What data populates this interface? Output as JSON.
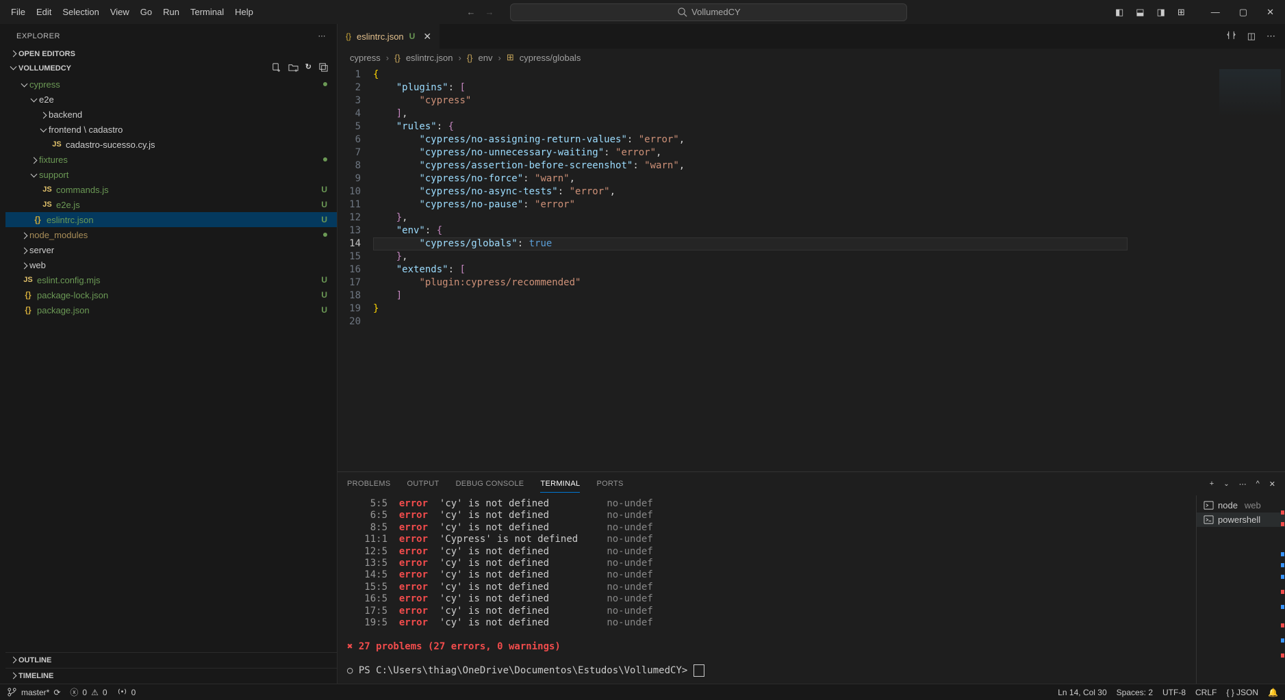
{
  "menubar": [
    "File",
    "Edit",
    "Selection",
    "View",
    "Go",
    "Run",
    "Terminal",
    "Help"
  ],
  "search_placeholder": "VollumedCY",
  "sidebar": {
    "title": "EXPLORER",
    "open_editors": "OPEN EDITORS",
    "project": "VOLLUMEDCY",
    "tree": [
      {
        "depth": 1,
        "type": "folder",
        "open": true,
        "label": "cypress",
        "git": "dot",
        "cls": "clr-green"
      },
      {
        "depth": 2,
        "type": "folder",
        "open": true,
        "label": "e2e"
      },
      {
        "depth": 3,
        "type": "folder",
        "open": false,
        "label": "backend"
      },
      {
        "depth": 3,
        "type": "folder",
        "open": true,
        "label": "frontend \\ cadastro"
      },
      {
        "depth": 4,
        "type": "file",
        "icon": "JS",
        "iconcls": "ic-js",
        "label": "cadastro-sucesso.cy.js"
      },
      {
        "depth": 2,
        "type": "folder",
        "open": false,
        "label": "fixtures",
        "git": "dot",
        "cls": "clr-green"
      },
      {
        "depth": 2,
        "type": "folder",
        "open": true,
        "label": "support",
        "cls": "clr-green"
      },
      {
        "depth": 3,
        "type": "file",
        "icon": "JS",
        "iconcls": "ic-js",
        "label": "commands.js",
        "git": "U",
        "cls": "clr-green"
      },
      {
        "depth": 3,
        "type": "file",
        "icon": "JS",
        "iconcls": "ic-js",
        "label": "e2e.js",
        "git": "U",
        "cls": "clr-green"
      },
      {
        "depth": 2,
        "type": "file",
        "icon": "{}",
        "iconcls": "ic-json",
        "label": "eslintrc.json",
        "git": "U",
        "cls": "clr-green",
        "selected": true
      },
      {
        "depth": 1,
        "type": "folder",
        "open": false,
        "label": "node_modules",
        "git": "dot",
        "cls": "clr-mod"
      },
      {
        "depth": 1,
        "type": "folder",
        "open": false,
        "label": "server"
      },
      {
        "depth": 1,
        "type": "folder",
        "open": false,
        "label": "web"
      },
      {
        "depth": 1,
        "type": "file",
        "icon": "JS",
        "iconcls": "ic-js",
        "label": "eslint.config.mjs",
        "git": "U",
        "cls": "clr-green"
      },
      {
        "depth": 1,
        "type": "file",
        "icon": "{}",
        "iconcls": "ic-json",
        "label": "package-lock.json",
        "git": "U",
        "cls": "clr-green"
      },
      {
        "depth": 1,
        "type": "file",
        "icon": "{}",
        "iconcls": "ic-json",
        "label": "package.json",
        "git": "U",
        "cls": "clr-green"
      }
    ],
    "outline": "OUTLINE",
    "timeline": "TIMELINE"
  },
  "tab": {
    "icon": "{}",
    "name": "eslintrc.json",
    "badge": "U"
  },
  "breadcrumb": [
    "cypress",
    "eslintrc.json",
    "env",
    "cypress/globals"
  ],
  "code": {
    "lines": [
      [
        [
          "brace",
          "{"
        ]
      ],
      [
        [
          "punc",
          "    "
        ],
        [
          "key",
          "\"plugins\""
        ],
        [
          "punc",
          ": "
        ],
        [
          "brace2",
          "["
        ]
      ],
      [
        [
          "punc",
          "        "
        ],
        [
          "str",
          "\"cypress\""
        ]
      ],
      [
        [
          "punc",
          "    "
        ],
        [
          "brace2",
          "]"
        ],
        [
          "punc",
          ","
        ]
      ],
      [
        [
          "punc",
          "    "
        ],
        [
          "key",
          "\"rules\""
        ],
        [
          "punc",
          ": "
        ],
        [
          "brace2",
          "{"
        ]
      ],
      [
        [
          "punc",
          "        "
        ],
        [
          "key",
          "\"cypress/no-assigning-return-values\""
        ],
        [
          "punc",
          ": "
        ],
        [
          "str",
          "\"error\""
        ],
        [
          "punc",
          ","
        ]
      ],
      [
        [
          "punc",
          "        "
        ],
        [
          "key",
          "\"cypress/no-unnecessary-waiting\""
        ],
        [
          "punc",
          ": "
        ],
        [
          "str",
          "\"error\""
        ],
        [
          "punc",
          ","
        ]
      ],
      [
        [
          "punc",
          "        "
        ],
        [
          "key",
          "\"cypress/assertion-before-screenshot\""
        ],
        [
          "punc",
          ": "
        ],
        [
          "str",
          "\"warn\""
        ],
        [
          "punc",
          ","
        ]
      ],
      [
        [
          "punc",
          "        "
        ],
        [
          "key",
          "\"cypress/no-force\""
        ],
        [
          "punc",
          ": "
        ],
        [
          "str",
          "\"warn\""
        ],
        [
          "punc",
          ","
        ]
      ],
      [
        [
          "punc",
          "        "
        ],
        [
          "key",
          "\"cypress/no-async-tests\""
        ],
        [
          "punc",
          ": "
        ],
        [
          "str",
          "\"error\""
        ],
        [
          "punc",
          ","
        ]
      ],
      [
        [
          "punc",
          "        "
        ],
        [
          "key",
          "\"cypress/no-pause\""
        ],
        [
          "punc",
          ": "
        ],
        [
          "str",
          "\"error\""
        ]
      ],
      [
        [
          "punc",
          "    "
        ],
        [
          "brace2",
          "}"
        ],
        [
          "punc",
          ","
        ]
      ],
      [
        [
          "punc",
          "    "
        ],
        [
          "key",
          "\"env\""
        ],
        [
          "punc",
          ": "
        ],
        [
          "brace2",
          "{"
        ]
      ],
      [
        [
          "punc",
          "        "
        ],
        [
          "key",
          "\"cypress/globals\""
        ],
        [
          "punc",
          ": "
        ],
        [
          "bool",
          "true"
        ]
      ],
      [
        [
          "punc",
          "    "
        ],
        [
          "brace2",
          "}"
        ],
        [
          "punc",
          ","
        ]
      ],
      [
        [
          "punc",
          "    "
        ],
        [
          "key",
          "\"extends\""
        ],
        [
          "punc",
          ": "
        ],
        [
          "brace2",
          "["
        ]
      ],
      [
        [
          "punc",
          "        "
        ],
        [
          "str",
          "\"plugin:cypress/recommended\""
        ]
      ],
      [
        [
          "punc",
          "    "
        ],
        [
          "brace2",
          "]"
        ]
      ],
      [
        [
          "punc",
          ""
        ]
      ],
      [
        [
          "brace",
          "}"
        ]
      ]
    ],
    "highlight_line": 14
  },
  "panel": {
    "tabs": [
      "PROBLEMS",
      "OUTPUT",
      "DEBUG CONSOLE",
      "TERMINAL",
      "PORTS"
    ],
    "active": "TERMINAL",
    "errors": [
      {
        "pos": "5:5",
        "sev": "error",
        "msg": "'cy' is not defined",
        "rule": "no-undef"
      },
      {
        "pos": "6:5",
        "sev": "error",
        "msg": "'cy' is not defined",
        "rule": "no-undef"
      },
      {
        "pos": "8:5",
        "sev": "error",
        "msg": "'cy' is not defined",
        "rule": "no-undef"
      },
      {
        "pos": "11:1",
        "sev": "error",
        "msg": "'Cypress' is not defined",
        "rule": "no-undef"
      },
      {
        "pos": "12:5",
        "sev": "error",
        "msg": "'cy' is not defined",
        "rule": "no-undef"
      },
      {
        "pos": "13:5",
        "sev": "error",
        "msg": "'cy' is not defined",
        "rule": "no-undef"
      },
      {
        "pos": "14:5",
        "sev": "error",
        "msg": "'cy' is not defined",
        "rule": "no-undef"
      },
      {
        "pos": "15:5",
        "sev": "error",
        "msg": "'cy' is not defined",
        "rule": "no-undef"
      },
      {
        "pos": "16:5",
        "sev": "error",
        "msg": "'cy' is not defined",
        "rule": "no-undef"
      },
      {
        "pos": "17:5",
        "sev": "error",
        "msg": "'cy' is not defined",
        "rule": "no-undef"
      },
      {
        "pos": "19:5",
        "sev": "error",
        "msg": "'cy' is not defined",
        "rule": "no-undef"
      }
    ],
    "summary": "27 problems (27 errors, 0 warnings)",
    "prompt": "PS C:\\Users\\thiag\\OneDrive\\Documentos\\Estudos\\VollumedCY>",
    "terminals": [
      {
        "icon": "node",
        "label": "node",
        "extra": "web"
      },
      {
        "icon": "ps",
        "label": "powershell",
        "active": true
      }
    ]
  },
  "status": {
    "branch": "master*",
    "sync": "",
    "errors": "0",
    "warnings": "0",
    "ports": "0",
    "cursor": "Ln 14, Col 30",
    "spaces": "Spaces: 2",
    "encoding": "UTF-8",
    "eol": "CRLF",
    "lang": "{ } JSON"
  }
}
